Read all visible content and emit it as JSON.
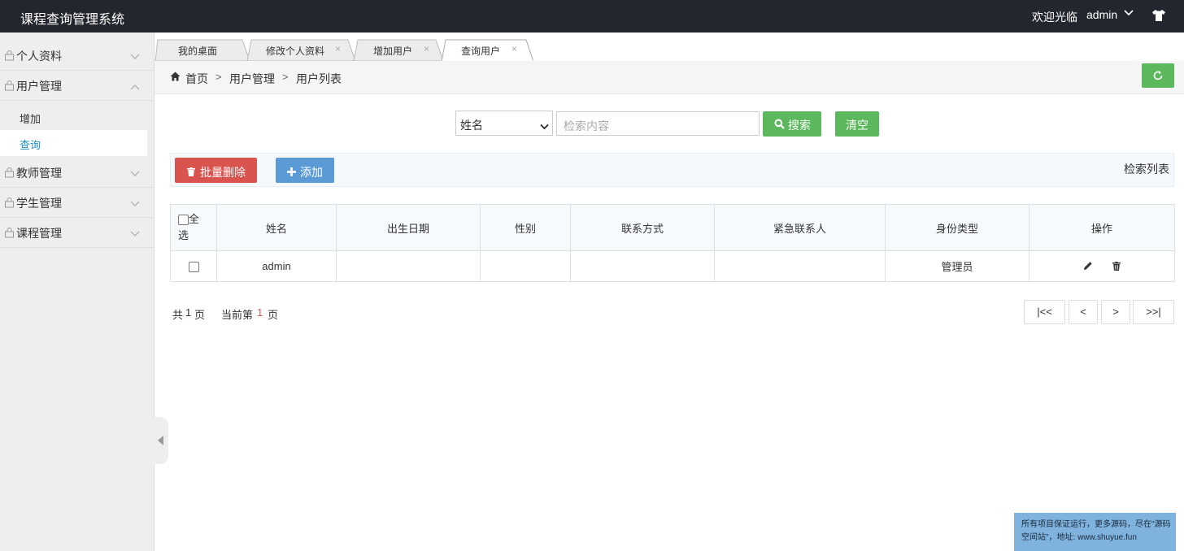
{
  "header": {
    "app_title": "课程查询管理系统",
    "welcome": "欢迎光临",
    "username": "admin",
    "user_caret_icon": "chevron-down-icon",
    "theme_icon": "shirt-icon"
  },
  "sidebar": {
    "items": [
      {
        "label": "个人资料",
        "expanded": false
      },
      {
        "label": "用户管理",
        "expanded": true,
        "children": [
          {
            "label": "增加",
            "active": false
          },
          {
            "label": "查询",
            "active": true
          }
        ]
      },
      {
        "label": "教师管理",
        "expanded": false
      },
      {
        "label": "学生管理",
        "expanded": false
      },
      {
        "label": "课程管理",
        "expanded": false
      }
    ]
  },
  "tabs": [
    {
      "label": "我的桌面",
      "closable": false,
      "active": false
    },
    {
      "label": "修改个人资料",
      "closable": true,
      "active": false
    },
    {
      "label": "增加用户",
      "closable": true,
      "active": false
    },
    {
      "label": "查询用户",
      "closable": true,
      "active": true
    }
  ],
  "tab_close_glyph": "×",
  "breadcrumb": [
    "首页",
    "用户管理",
    "用户列表"
  ],
  "breadcrumb_separator": ">",
  "search": {
    "field_selected": "姓名",
    "placeholder": "检索内容",
    "search_label": "搜索",
    "clear_label": "清空"
  },
  "toolbar": {
    "batch_delete_label": "批量删除",
    "add_label": "添加",
    "list_title": "检索列表"
  },
  "table": {
    "select_all_label": "全选",
    "columns": [
      "姓名",
      "出生日期",
      "性别",
      "联系方式",
      "紧急联系人",
      "身份类型",
      "操作"
    ],
    "rows": [
      {
        "name": "admin",
        "birth_date": "",
        "gender": "",
        "contact": "",
        "emergency_contact": "",
        "role": "管理员"
      }
    ]
  },
  "pagination": {
    "total_prefix": "共",
    "total_pages": "1",
    "total_suffix": "页",
    "current_prefix": "当前第",
    "current_page": "1",
    "current_suffix": "页",
    "first": "|<<",
    "prev": "<",
    "next": ">",
    "last": ">>|"
  },
  "watermark": "所有项目保证运行，更多源码，尽在\"源码空间站\"，地址: www.shuyue.fun",
  "colors": {
    "topbar": "#23262e",
    "sidebar": "#eeeeee",
    "active_link": "#1e8fbd",
    "green": "#5cb85c",
    "red": "#d9534f",
    "blue": "#5b9bd5"
  }
}
